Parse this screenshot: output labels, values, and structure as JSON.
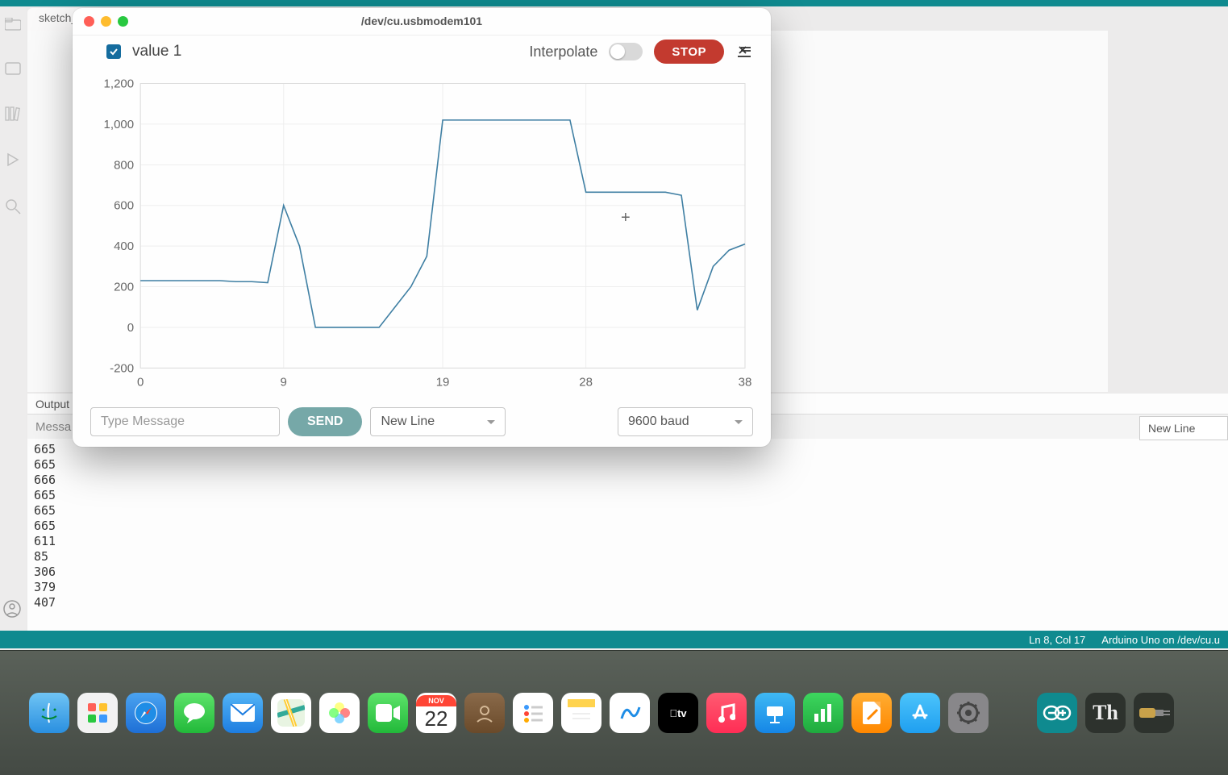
{
  "background": {
    "tab_label": "sketch_",
    "output": {
      "header": "Output",
      "message_label": "Messa",
      "newline_dropdown": "New Line",
      "log_lines": [
        "665",
        "665",
        "666",
        "665",
        "665",
        "665",
        "611",
        "85",
        "306",
        "379",
        "407"
      ]
    },
    "statusbar": {
      "cursor": "Ln 8, Col 17",
      "board": "Arduino Uno on /dev/cu.u"
    }
  },
  "plotter": {
    "title": "/dev/cu.usbmodem101",
    "legend": {
      "series_label": "value 1",
      "checked": true
    },
    "interpolate_label": "Interpolate",
    "interpolate_on": false,
    "stop_label": "STOP",
    "message_placeholder": "Type Message",
    "send_label": "SEND",
    "line_ending": "New Line",
    "baud": "9600 baud",
    "cursor_marker": "+"
  },
  "chart_data": {
    "type": "line",
    "title": "",
    "xlabel": "",
    "ylabel": "",
    "xlim": [
      0,
      38
    ],
    "ylim": [
      -200,
      1200
    ],
    "x_ticks": [
      0,
      9,
      19,
      28,
      38
    ],
    "y_ticks": [
      -200,
      0,
      200,
      400,
      600,
      800,
      1000,
      1200
    ],
    "series": [
      {
        "name": "value 1",
        "color": "#3f7fa3",
        "x": [
          0,
          1,
          2,
          3,
          4,
          5,
          6,
          7,
          8,
          9,
          10,
          11,
          12,
          13,
          14,
          15,
          16,
          17,
          18,
          19,
          20,
          21,
          22,
          23,
          24,
          25,
          26,
          27,
          28,
          29,
          30,
          31,
          32,
          33,
          34,
          35,
          36,
          37,
          38
        ],
        "values": [
          230,
          230,
          230,
          230,
          230,
          230,
          225,
          225,
          220,
          600,
          400,
          0,
          0,
          0,
          0,
          0,
          100,
          200,
          350,
          1020,
          1020,
          1020,
          1020,
          1020,
          1020,
          1020,
          1020,
          1020,
          665,
          665,
          665,
          665,
          665,
          665,
          650,
          85,
          300,
          380,
          410
        ]
      }
    ]
  },
  "dock": {
    "date_month": "NOV",
    "date_day": "22"
  }
}
